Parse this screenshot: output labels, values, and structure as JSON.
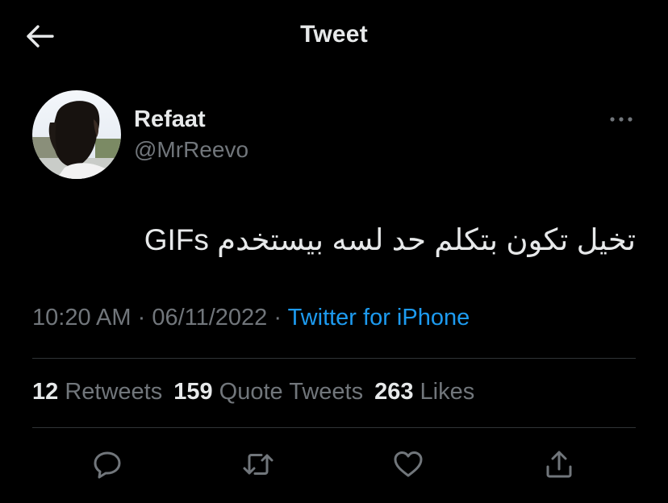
{
  "header": {
    "title": "Tweet",
    "back_icon": "arrow-left-icon"
  },
  "author": {
    "display_name": "Refaat",
    "handle": "@MrReevo",
    "avatar_icon": "profile-photo",
    "more_icon": "more-horizontal-icon"
  },
  "tweet": {
    "text": "تخيل تكون بتكلم حد لسه بيستخدم GIFs",
    "time": "10:20 AM",
    "separator": " · ",
    "date": "06/11/2022",
    "source": "Twitter for iPhone"
  },
  "stats": {
    "retweets_count": "12",
    "retweets_label": "Retweets",
    "quotes_count": "159",
    "quotes_label": "Quote Tweets",
    "likes_count": "263",
    "likes_label": "Likes"
  },
  "actions": [
    {
      "icon": "reply-icon"
    },
    {
      "icon": "retweet-icon"
    },
    {
      "icon": "like-icon"
    },
    {
      "icon": "share-icon"
    }
  ],
  "colors": {
    "background": "#000000",
    "text_primary": "#e7e9ea",
    "text_secondary": "#71767b",
    "accent": "#1d9bf0",
    "divider": "#2f3336"
  }
}
